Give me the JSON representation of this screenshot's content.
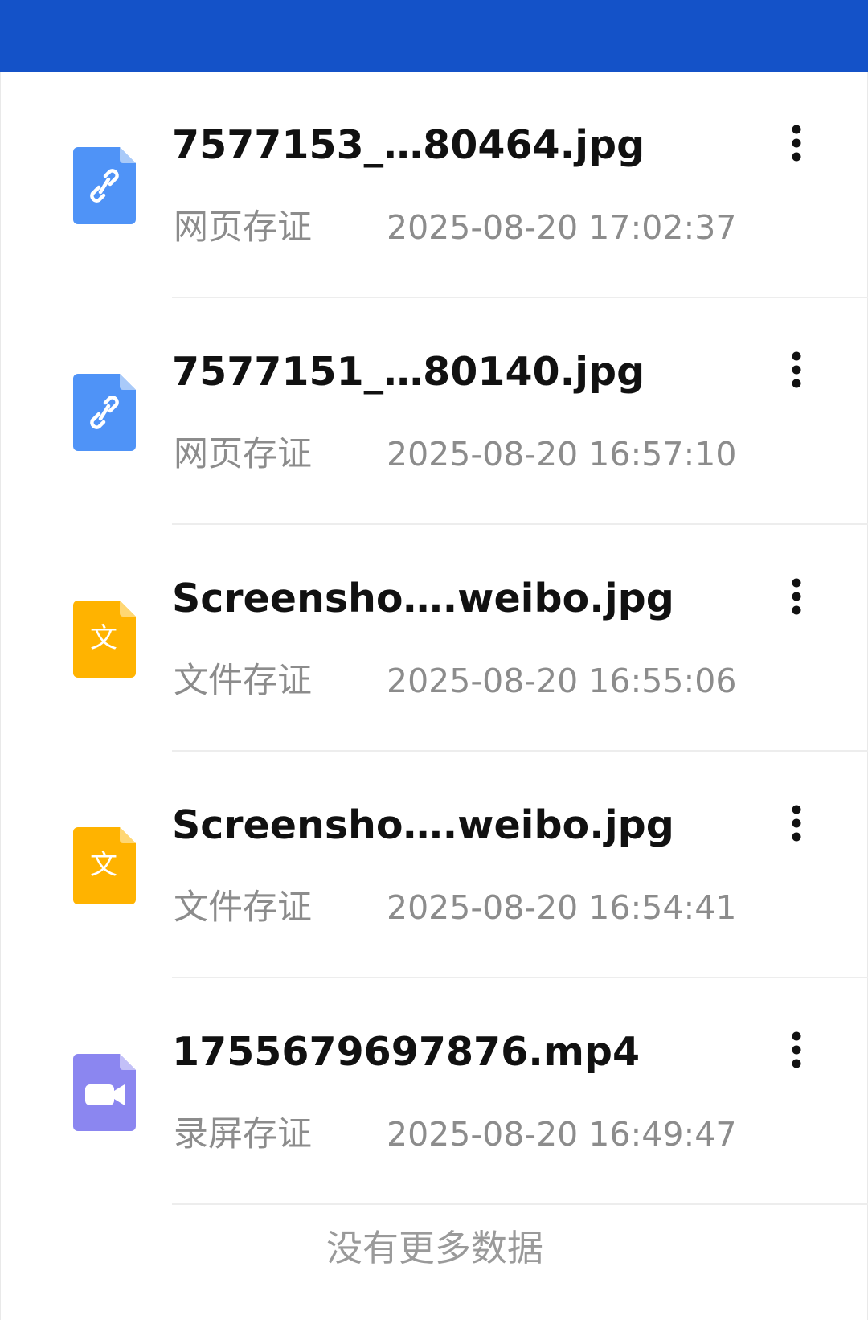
{
  "colors": {
    "header": "#1452c8",
    "link_icon": "#4f93f7",
    "doc_icon": "#ffb300",
    "video_icon": "#8b86f0",
    "title_text": "#111111",
    "meta_text": "#8c8c8c"
  },
  "records": [
    {
      "icon": "link-file-icon",
      "file_name": "7577153_…80464.jpg",
      "type": "网页存证",
      "time": "2025-08-20 17:02:37"
    },
    {
      "icon": "link-file-icon",
      "file_name": "7577151_…80140.jpg",
      "type": "网页存证",
      "time": "2025-08-20 16:57:10"
    },
    {
      "icon": "document-file-icon",
      "icon_glyph": "文",
      "file_name": "Screensho….weibo.jpg",
      "type": "文件存证",
      "time": "2025-08-20 16:55:06"
    },
    {
      "icon": "document-file-icon",
      "icon_glyph": "文",
      "file_name": "Screensho….weibo.jpg",
      "type": "文件存证",
      "time": "2025-08-20 16:54:41"
    },
    {
      "icon": "video-file-icon",
      "file_name": "1755679697876.mp4",
      "type": "录屏存证",
      "time": "2025-08-20 16:49:47"
    }
  ],
  "footer": {
    "no_more_text": "没有更多数据"
  }
}
